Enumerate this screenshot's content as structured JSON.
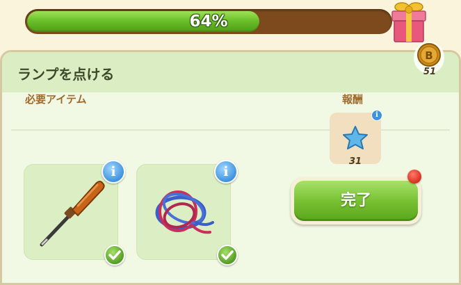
{
  "progress": {
    "percent_text": "64%",
    "fraction": 0.64
  },
  "quest": {
    "title": "ランプを点ける"
  },
  "currency": {
    "coin_count": "51",
    "coin_symbol": "B"
  },
  "required": {
    "label": "必要アイテム",
    "items": [
      {
        "name": "screwdriver",
        "info": "i",
        "fulfilled": true
      },
      {
        "name": "tangled-wires",
        "info": "i",
        "fulfilled": true
      }
    ]
  },
  "reward": {
    "label": "報酬",
    "count": "31",
    "info": "i"
  },
  "actions": {
    "complete_label": "完了"
  },
  "colors": {
    "progress_fill": "#6cc02a",
    "progress_track": "#7c4a1d",
    "panel_bg": "#f1f8e4",
    "header_bg": "#dbeec3",
    "accent_label": "#a06a2c",
    "button_green": "#79c233",
    "badge_blue": "#3f93de",
    "notification_red": "#d42a1a"
  }
}
